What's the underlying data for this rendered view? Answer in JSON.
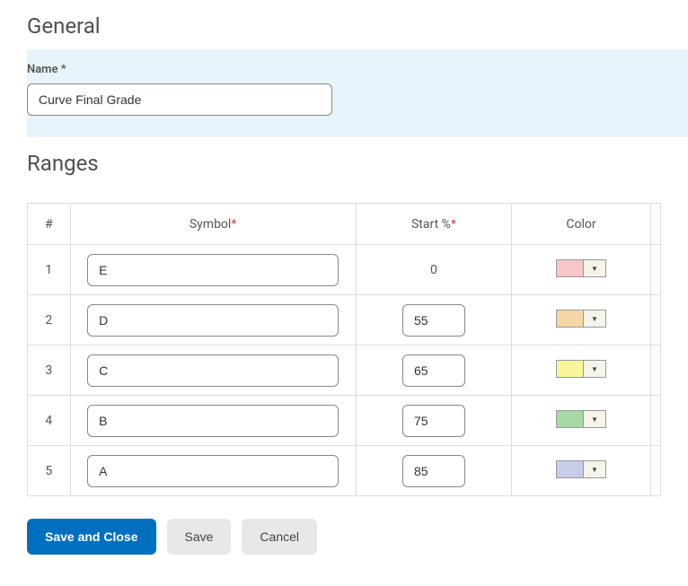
{
  "headings": {
    "general": "General",
    "ranges": "Ranges"
  },
  "name_field": {
    "label": "Name *",
    "value": "Curve Final Grade"
  },
  "table": {
    "headers": {
      "num": "#",
      "symbol": "Symbol",
      "start": "Start %",
      "color": "Color"
    },
    "rows": [
      {
        "num": "1",
        "symbol": "E",
        "start": "0",
        "start_editable": false,
        "color": "#f7c6c6"
      },
      {
        "num": "2",
        "symbol": "D",
        "start": "55",
        "start_editable": true,
        "color": "#f7d6a6"
      },
      {
        "num": "3",
        "symbol": "C",
        "start": "65",
        "start_editable": true,
        "color": "#f7f59a"
      },
      {
        "num": "4",
        "symbol": "B",
        "start": "75",
        "start_editable": true,
        "color": "#a6d9a6"
      },
      {
        "num": "5",
        "symbol": "A",
        "start": "85",
        "start_editable": true,
        "color": "#c6cde8"
      }
    ]
  },
  "buttons": {
    "save_close": "Save and Close",
    "save": "Save",
    "cancel": "Cancel"
  }
}
